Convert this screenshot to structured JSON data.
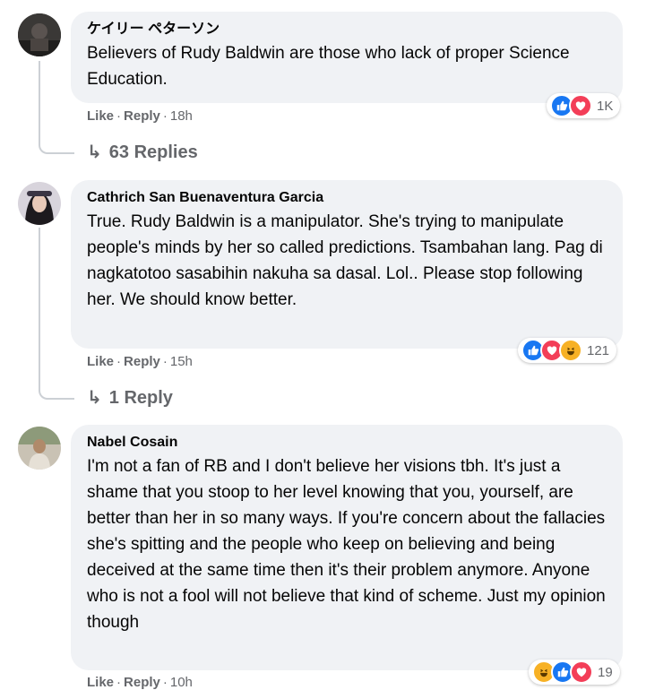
{
  "comments": [
    {
      "author": "ケイリー ペターソン",
      "text": "Believers of Rudy Baldwin are those who lack of proper Science Education.",
      "like_label": "Like",
      "reply_label": "Reply",
      "time": "18h",
      "reaction_count": "1K",
      "reactions": [
        "like",
        "love"
      ],
      "replies_label": "63 Replies"
    },
    {
      "author": "Cathrich San Buenaventura Garcia",
      "text": "True. Rudy Baldwin is a manipulator. She's trying to manipulate people's minds by her so called predictions. Tsambahan lang. Pag di nagkatotoo sasabihin nakuha sa dasal. Lol.. Please stop following her. We should know better.",
      "like_label": "Like",
      "reply_label": "Reply",
      "time": "15h",
      "reaction_count": "121",
      "reactions": [
        "like",
        "love",
        "haha"
      ],
      "replies_label": "1 Reply"
    },
    {
      "author": "Nabel Cosain",
      "text": "I'm not a fan of RB and I don't believe her visions tbh. It's just a shame that you stoop to her level knowing that you, yourself, are better than her in so many ways. If you're concern about the fallacies she's spitting and the people who keep on believing and being deceived at the same time then it's their problem anymore. Anyone who is not a fool will not believe that kind of scheme. Just my opinion though",
      "like_label": "Like",
      "reply_label": "Reply",
      "time": "10h",
      "reaction_count": "19",
      "reactions": [
        "haha",
        "like",
        "love"
      ]
    }
  ],
  "colors": {
    "bubble": "#f0f2f5",
    "meta_text": "#65676b",
    "like": "#1877f2",
    "love": "#f33e58",
    "haha": "#f7b125"
  }
}
